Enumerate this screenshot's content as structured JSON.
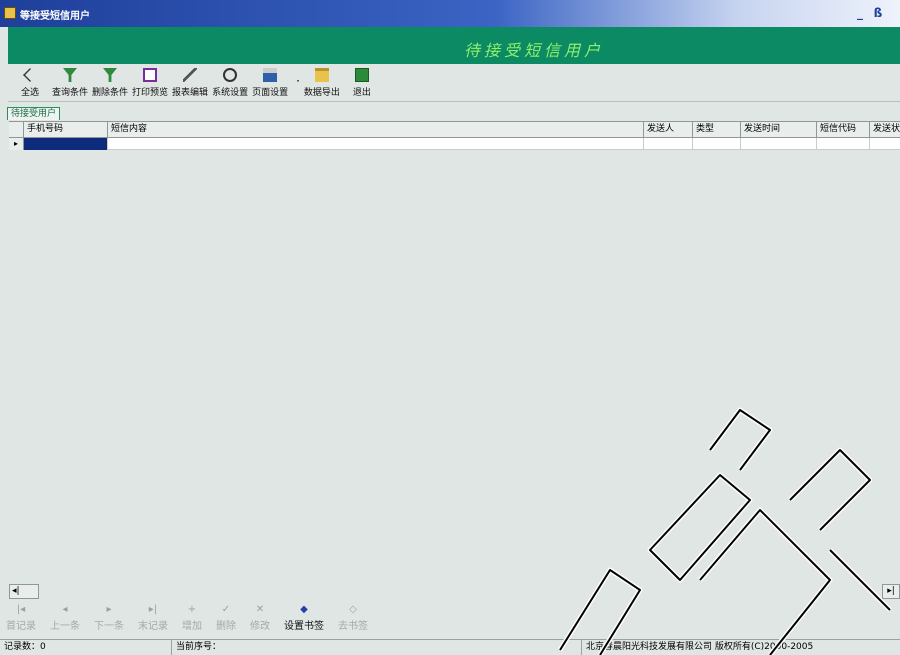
{
  "window": {
    "title": "等接受短信用户",
    "min_glyph": "_",
    "max_glyph": "ß"
  },
  "banner": {
    "title": "待接受短信用户"
  },
  "toolbar": {
    "items": [
      {
        "label": "全选",
        "icon": "back-arrow-icon"
      },
      {
        "label": "查询条件",
        "icon": "filter-icon"
      },
      {
        "label": "删除条件",
        "icon": "filter-remove-icon"
      },
      {
        "label": "打印预览",
        "icon": "print-preview-icon"
      },
      {
        "label": "报表编辑",
        "icon": "edit-icon"
      },
      {
        "label": "系统设置",
        "icon": "clock-icon"
      },
      {
        "label": "页面设置",
        "icon": "printer-icon"
      },
      {
        "label": "数据导出",
        "icon": "folder-icon"
      },
      {
        "label": "退出",
        "icon": "exit-door-icon"
      }
    ]
  },
  "tab": {
    "label": "待接受用户"
  },
  "grid": {
    "columns": [
      "手机号码",
      "短信内容",
      "发送人",
      "类型",
      "发送时间",
      "短信代码",
      "发送状"
    ],
    "row_marker": "▸"
  },
  "scroll": {
    "left": "◂|",
    "right": "▸|"
  },
  "navigator": {
    "items": [
      {
        "label": "首记录",
        "glyph": "|◂",
        "active": false
      },
      {
        "label": "上一条",
        "glyph": "◂",
        "active": false
      },
      {
        "label": "下一条",
        "glyph": "▸",
        "active": false
      },
      {
        "label": "末记录",
        "glyph": "▸|",
        "active": false
      },
      {
        "label": "增加",
        "glyph": "+",
        "active": false
      },
      {
        "label": "删除",
        "glyph": "✓",
        "active": false
      },
      {
        "label": "修改",
        "glyph": "✕",
        "active": false
      },
      {
        "label": "设置书签",
        "glyph": "◆",
        "active": true
      },
      {
        "label": "去书签",
        "glyph": "◇",
        "active": false
      }
    ]
  },
  "status": {
    "records": "记录数：0",
    "current": "当前序号：",
    "company": "北京春晨阳光科技发展有限公司  版权所有(C)2000-2005"
  },
  "colors": {
    "banner": "#0b8a63",
    "banner_text": "#8df06e",
    "selection": "#0e2a7a"
  }
}
